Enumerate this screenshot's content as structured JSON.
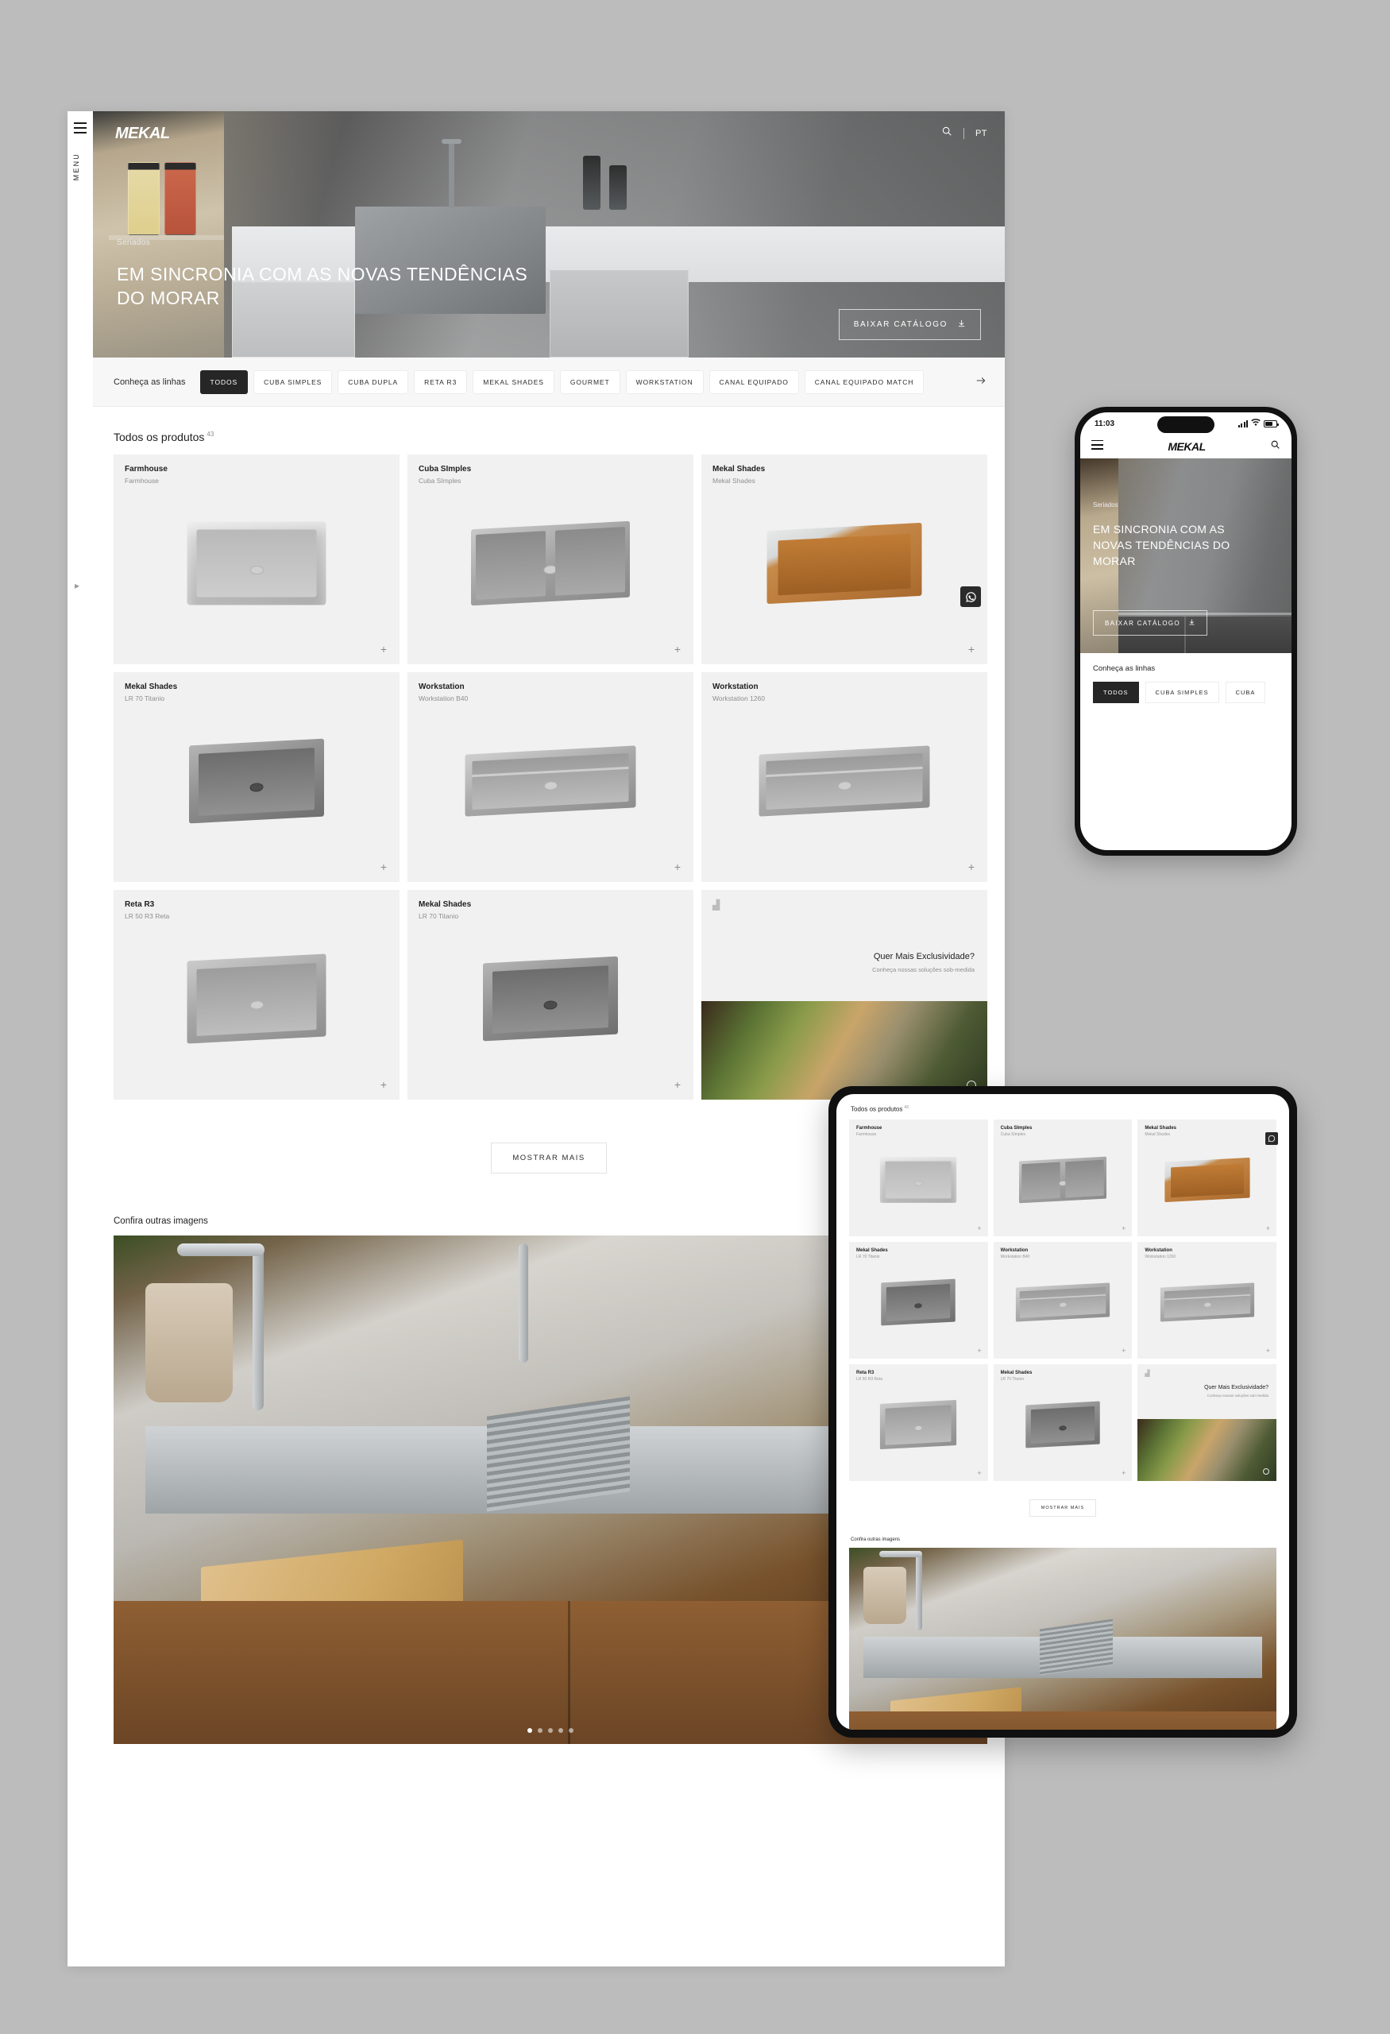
{
  "brand": {
    "logo": "MEKAL"
  },
  "desktop": {
    "rail": {
      "menu_label": "MENU",
      "burger_icon": "hamburger-icon",
      "side_arrow": "▸"
    },
    "header": {
      "search_icon": "search-icon",
      "language": "PT"
    },
    "hero": {
      "category": "Seriados",
      "title": "EM SINCRONIA COM AS NOVAS TENDÊNCIAS DO MORAR",
      "cta": "BAIXAR CATÁLOGO",
      "cta_icon": "download-icon"
    },
    "filters": {
      "label": "Conheça as linhas",
      "next_icon": "arrow-right-icon",
      "chips": [
        {
          "label": "TODOS",
          "active": true
        },
        {
          "label": "CUBA SIMPLES",
          "active": false
        },
        {
          "label": "CUBA DUPLA",
          "active": false
        },
        {
          "label": "RETA R3",
          "active": false
        },
        {
          "label": "MEKAL SHADES",
          "active": false
        },
        {
          "label": "GOURMET",
          "active": false
        },
        {
          "label": "WORKSTATION",
          "active": false
        },
        {
          "label": "CANAL EQUIPADO",
          "active": false
        },
        {
          "label": "CANAL EQUIPADO MATCH",
          "active": false
        }
      ]
    },
    "products": {
      "heading": "Todos os produtos",
      "count": "43",
      "add_icon": "plus-icon",
      "items": [
        {
          "line": "Farmhouse",
          "model": "Farmhouse"
        },
        {
          "line": "Cuba SImples",
          "model": "Cuba SImples"
        },
        {
          "line": "Mekal Shades",
          "model": "Mekal Shades"
        },
        {
          "line": "Mekal Shades",
          "model": "LR 70 Titanio"
        },
        {
          "line": "Workstation",
          "model": "Workstation B40"
        },
        {
          "line": "Workstation",
          "model": "Workstation 1260"
        },
        {
          "line": "Reta R3",
          "model": "LR 50 R3 Reta"
        },
        {
          "line": "Mekal Shades",
          "model": "LR 70 Titanio"
        }
      ],
      "promo": {
        "title": "Quer Mais Exclusividade?",
        "subtitle": "Conheça nossas soluções sob-medida"
      },
      "show_more": "MOSTRAR MAIS"
    },
    "gallery": {
      "heading": "Confira outras imagens",
      "dots": 5,
      "active_dot": 1
    },
    "whatsapp_icon": "whatsapp-icon"
  },
  "phone": {
    "status": {
      "time": "11:03",
      "signal_icon": "cellular-icon",
      "wifi_icon": "wifi-icon",
      "battery_icon": "battery-icon"
    },
    "nav": {
      "menu_icon": "hamburger-icon",
      "search_icon": "search-icon"
    },
    "hero": {
      "category": "Seriados",
      "title": "EM SINCRONIA COM AS NOVAS TENDÊNCIAS DO MORAR",
      "cta": "BAIXAR CATÁLOGO",
      "cta_icon": "download-icon"
    },
    "filters": {
      "label": "Conheça as linhas",
      "chips": [
        {
          "label": "TODOS",
          "active": true
        },
        {
          "label": "CUBA SIMPLES",
          "active": false
        },
        {
          "label": "CUBA",
          "active": false
        }
      ]
    }
  },
  "tablet": {
    "products": {
      "heading": "Todos os produtos",
      "count": "43",
      "items": [
        {
          "line": "Farmhouse",
          "model": "Farmhouse"
        },
        {
          "line": "Cuba SImples",
          "model": "Cuba SImples"
        },
        {
          "line": "Mekal Shades",
          "model": "Mekal Shades"
        },
        {
          "line": "Mekal Shades",
          "model": "LR 70 Titanio"
        },
        {
          "line": "Workstation",
          "model": "Workstation B40"
        },
        {
          "line": "Workstation",
          "model": "Workstation 1260"
        },
        {
          "line": "Reta R3",
          "model": "LR 50 R3 Reta"
        },
        {
          "line": "Mekal Shades",
          "model": "LR 70 Titanio"
        }
      ],
      "promo": {
        "title": "Quer Mais Exclusividade?",
        "subtitle": "Conheça nossas soluções sob-medida"
      },
      "show_more": "MOSTRAR MAIS"
    },
    "gallery": {
      "heading": "Confira outras imagens"
    },
    "whatsapp_icon": "whatsapp-icon"
  }
}
